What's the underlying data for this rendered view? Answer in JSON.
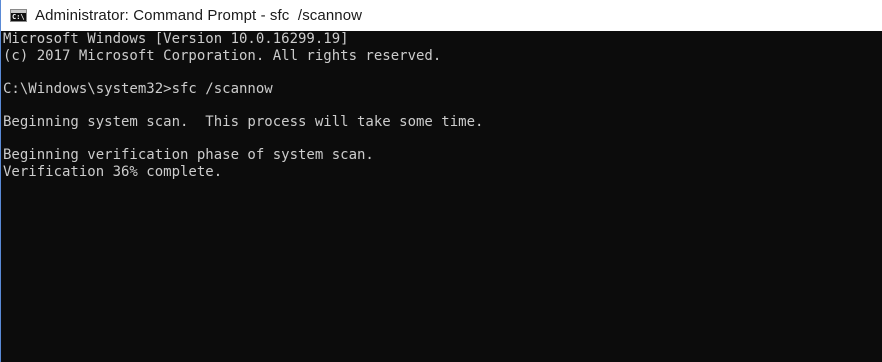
{
  "window": {
    "title": "Administrator: Command Prompt - sfc  /scannow",
    "icon": "cmd-icon",
    "icon_label": "C:\\."
  },
  "console": {
    "lines": [
      "Microsoft Windows [Version 10.0.16299.19]",
      "(c) 2017 Microsoft Corporation. All rights reserved.",
      "",
      "C:\\Windows\\system32>sfc /scannow",
      "",
      "Beginning system scan.  This process will take some time.",
      "",
      "Beginning verification phase of system scan.",
      "Verification 36% complete."
    ]
  },
  "colors": {
    "console_background": "#0c0c0c",
    "console_text": "#cccccc",
    "titlebar_background": "#ffffff",
    "window_border": "#5a8ad6"
  }
}
